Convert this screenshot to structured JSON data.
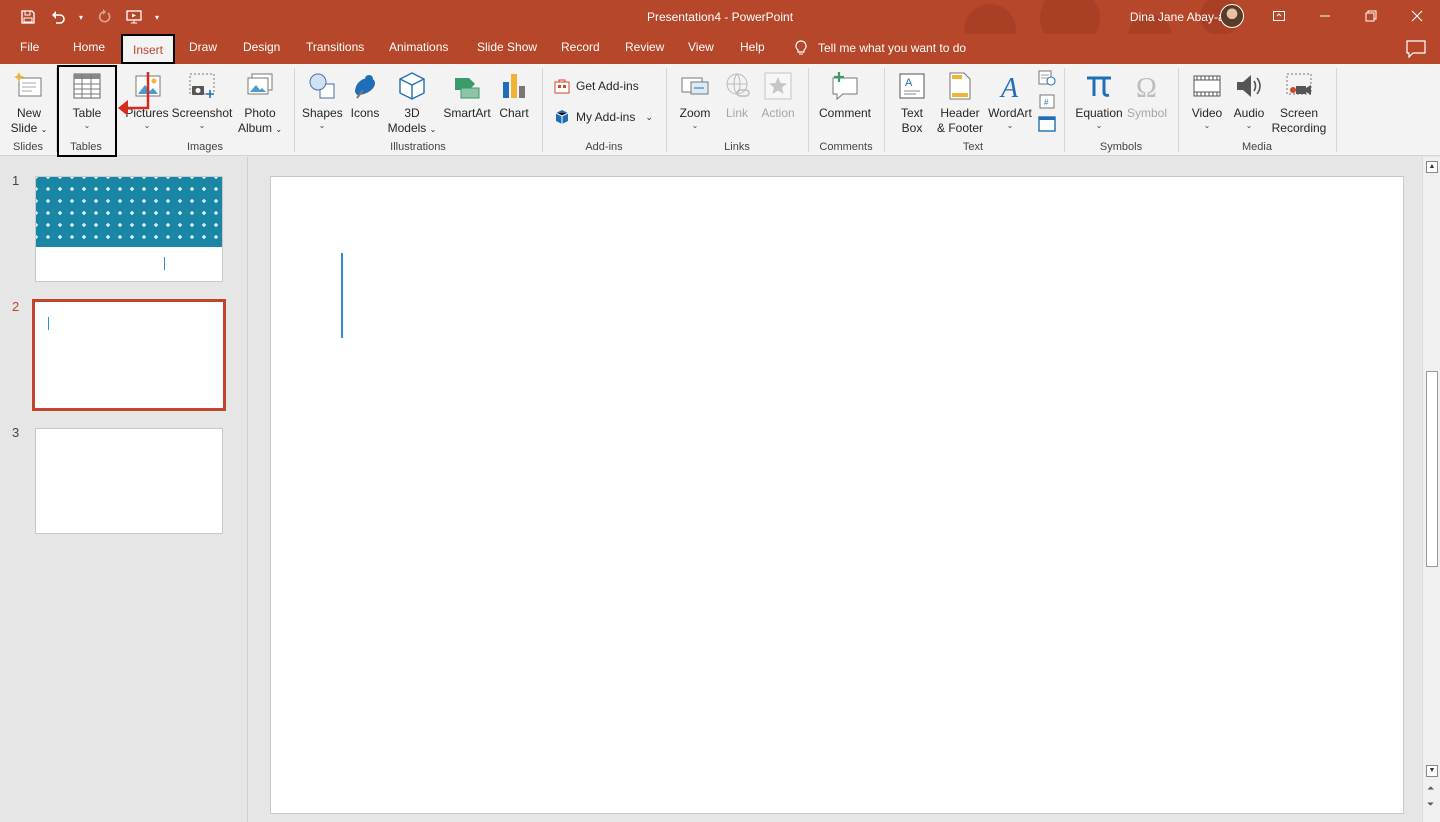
{
  "window": {
    "title": "Presentation4  -  PowerPoint",
    "user_name": "Dina Jane Abay-abay"
  },
  "menu": {
    "tabs": [
      "File",
      "Home",
      "Insert",
      "Draw",
      "Design",
      "Transitions",
      "Animations",
      "Slide Show",
      "Record",
      "Review",
      "View",
      "Help"
    ],
    "active_tab": "Insert",
    "tell_me": "Tell me what you want to do"
  },
  "ribbon": {
    "slides": {
      "new_slide_1": "New",
      "new_slide_2": "Slide",
      "group": "Slides"
    },
    "tables": {
      "table": "Table",
      "group": "Tables"
    },
    "images": {
      "pictures": "Pictures",
      "screenshot": "Screenshot",
      "photo_album_1": "Photo",
      "photo_album_2": "Album",
      "group": "Images"
    },
    "illustrations": {
      "shapes": "Shapes",
      "icons": "Icons",
      "models_1": "3D",
      "models_2": "Models",
      "smartart": "SmartArt",
      "chart": "Chart",
      "group": "Illustrations"
    },
    "addins": {
      "get_addins": "Get Add-ins",
      "my_addins": "My Add-ins",
      "group": "Add-ins"
    },
    "links": {
      "zoom": "Zoom",
      "link": "Link",
      "action": "Action",
      "group": "Links"
    },
    "comments": {
      "comment": "Comment",
      "group": "Comments"
    },
    "text": {
      "textbox_1": "Text",
      "textbox_2": "Box",
      "header_1": "Header",
      "header_2": "& Footer",
      "wordart": "WordArt",
      "group": "Text"
    },
    "symbols": {
      "equation": "Equation",
      "symbol": "Symbol",
      "group": "Symbols"
    },
    "media": {
      "video": "Video",
      "audio": "Audio",
      "screen_rec_1": "Screen",
      "screen_rec_2": "Recording",
      "group": "Media"
    }
  },
  "thumbnails": {
    "numbers": [
      "1",
      "2",
      "3"
    ],
    "selected": "2"
  },
  "colors": {
    "accent": "#b7472a",
    "slide_select": "#c0452c",
    "pattern": "#1a86a6",
    "caret": "#2b8fd0"
  }
}
